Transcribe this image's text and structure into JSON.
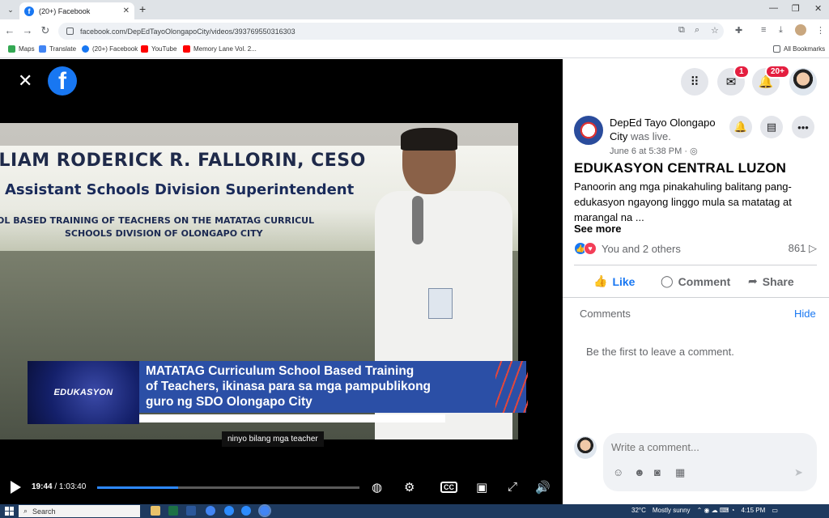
{
  "browser": {
    "tab_title": "(20+) Facebook",
    "url": "facebook.com/DepEdTayoOlongapoCity/videos/393769550316303",
    "bookmarks": [
      "Maps",
      "Translate",
      "(20+) Facebook",
      "YouTube",
      "Memory Lane Vol. 2...",
      "All Bookmarks"
    ]
  },
  "video": {
    "banner_lines": [
      "LLIAM RODERICK R. FALLORIN, CESO",
      "Assistant Schools Division Superintendent",
      "OL BASED TRAINING OF TEACHERS ON THE MATATAG CURRICUL",
      "SCHOOLS DIVISION OF OLONGAPO CITY"
    ],
    "lower_third_logo": "EDUKASYON",
    "headline_lines": [
      "MATATAG Curriculum School Based Training",
      "of Teachers, ikinasa para sa mga pampublikong",
      "guro ng SDO Olongapo City"
    ],
    "caption": "ninyo bilang mga teacher",
    "current_time": "19:44",
    "duration": "/ 1:03:40",
    "progress_percent": 31
  },
  "header": {
    "messenger_badge": "1",
    "notifications_badge": "20+"
  },
  "post": {
    "author": "DepEd Tayo Olongapo City",
    "status": "was live.",
    "date": "June 6 at 5:38 PM",
    "title": "EDUKASYON CENTRAL LUZON",
    "body": "Panoorin ang mga pinakahuling balitang pang-edukasyon ngayong linggo mula sa matatag at marangal na ...",
    "see_more": "See more",
    "reactions_text": "You and 2 others",
    "views": "861",
    "actions": {
      "like": "Like",
      "comment": "Comment",
      "share": "Share"
    },
    "comments_label": "Comments",
    "hide_label": "Hide",
    "empty_comments": "Be the first to leave a comment.",
    "composer_placeholder": "Write a comment..."
  },
  "taskbar": {
    "search_label": "Search",
    "weather": "32°C",
    "weather_desc": "Mostly sunny",
    "clock": "4:15 PM"
  },
  "colors": {
    "facebook_blue": "#1877f2",
    "notification_red": "#e41e3f",
    "headline_blue": "#2b4fa6"
  },
  "icons": [
    "close-icon",
    "facebook-logo",
    "menu-grid-icon",
    "messenger-icon",
    "bell-icon",
    "play-icon",
    "settings-icon",
    "captions-icon",
    "fullscreen-icon",
    "volume-icon"
  ]
}
